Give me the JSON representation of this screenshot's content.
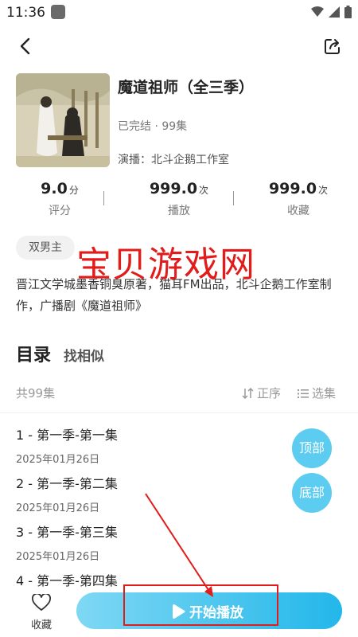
{
  "status_bar": {
    "time": "11:36",
    "icons": [
      "wifi-icon",
      "signal-icon",
      "battery-icon"
    ]
  },
  "nav": {
    "back_icon": "chevron-left-icon",
    "share_icon": "share-icon"
  },
  "album": {
    "title": "魔道祖师（全三季）",
    "status": "已完结 · 99集",
    "cast": "演播：北斗企鹅工作室"
  },
  "stats": [
    {
      "value": "9.0",
      "unit": "分",
      "label": "评分"
    },
    {
      "value": "999.0",
      "unit": "次",
      "label": "播放"
    },
    {
      "value": "999.0",
      "unit": "次",
      "label": "收藏"
    }
  ],
  "tag": "双男主",
  "watermark": "宝贝游戏网",
  "description": "晋江文学城墨香铜臭原著，猫耳FM出品，北斗企鹅工作室制作，广播剧《魔道祖师》",
  "catalog": {
    "title": "目录",
    "similar": "找相似",
    "count": "共99集",
    "sort_label": "正序",
    "select_label": "选集"
  },
  "episodes": [
    {
      "title": "1 - 第一季-第一集",
      "date": "2025年01月26日"
    },
    {
      "title": "2 - 第一季-第二集",
      "date": "2025年01月26日"
    },
    {
      "title": "3 - 第一季-第三集",
      "date": "2025年01月26日"
    },
    {
      "title": "4 - 第一季-第四集",
      "date": ""
    }
  ],
  "float_buttons": {
    "top": "顶部",
    "bottom": "底部"
  },
  "bottom_bar": {
    "favorite_label": "收藏",
    "play_label": "开始播放"
  },
  "colors": {
    "accent": "#23b7ea",
    "float_button": "#5ccdf0",
    "annotation": "#e21b1b"
  }
}
